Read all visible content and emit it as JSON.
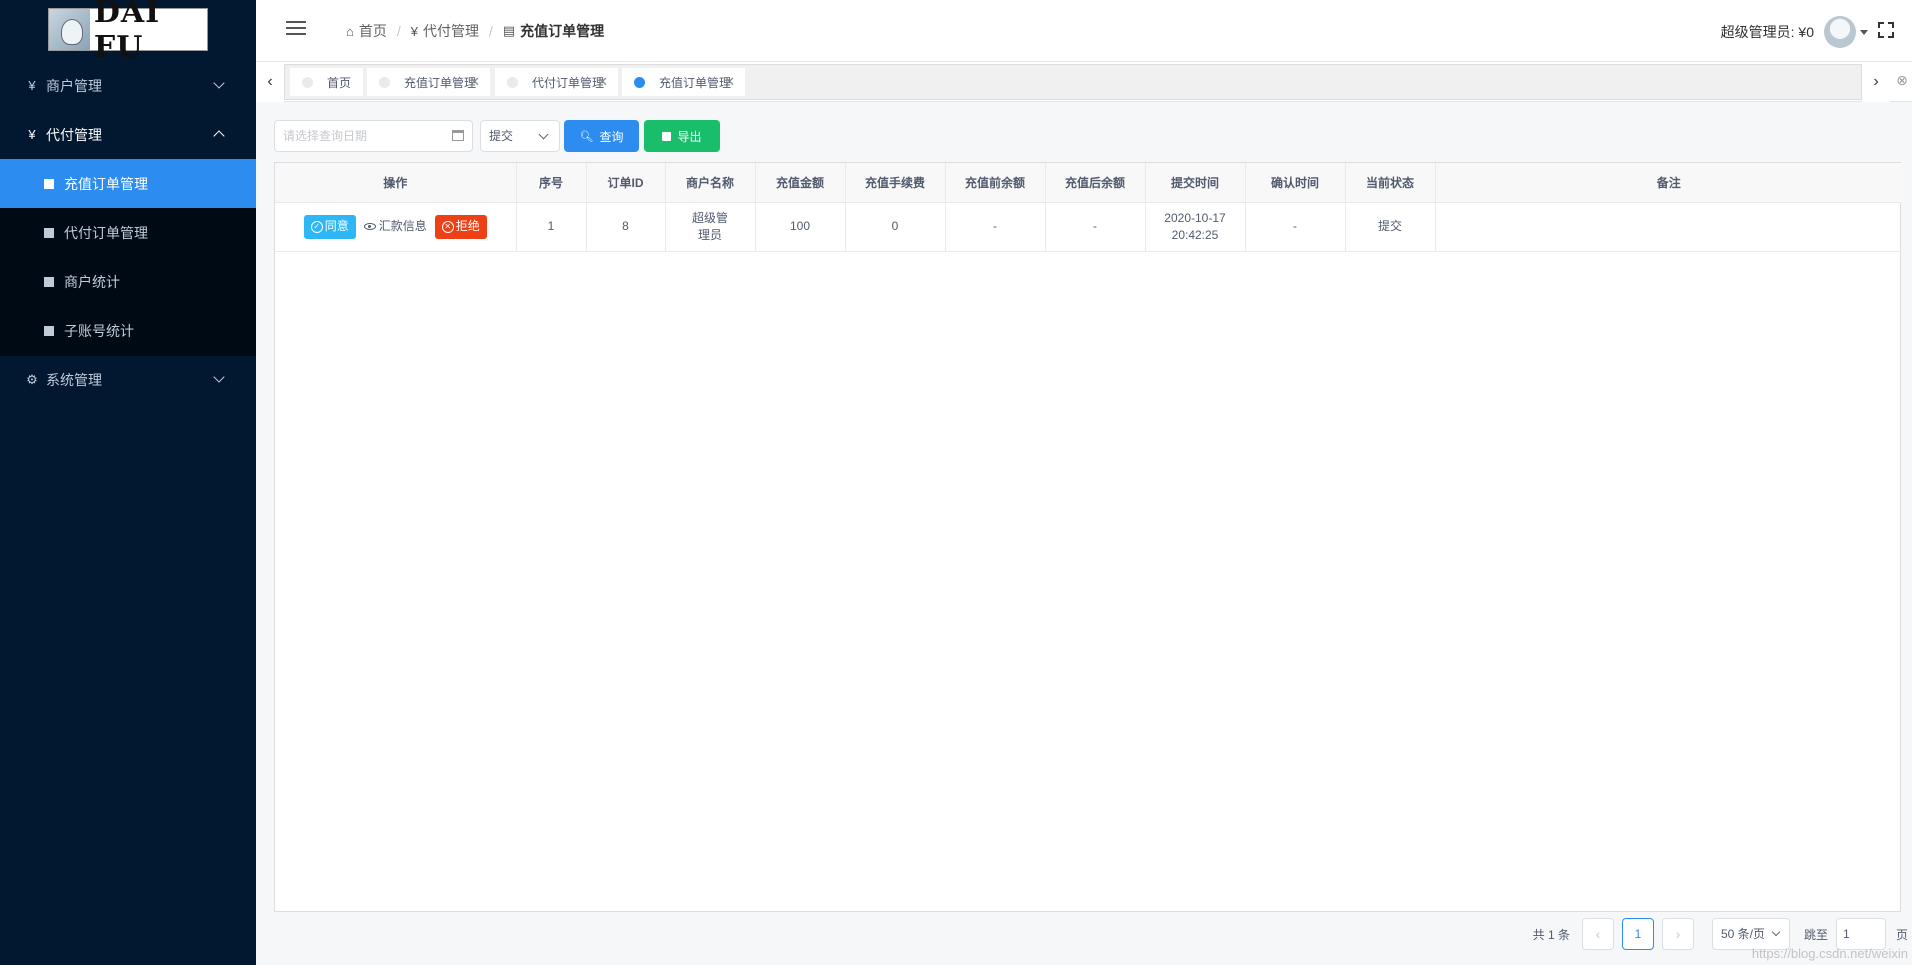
{
  "brand": {
    "logo_text": "DAI FU"
  },
  "sidebar": {
    "menus": [
      {
        "icon": "yen-icon",
        "glyph": "¥",
        "label": "商户管理",
        "expanded": false
      },
      {
        "icon": "yen-icon",
        "glyph": "¥",
        "label": "代付管理",
        "expanded": true
      },
      {
        "icon": "gear-icon",
        "glyph": "⚙",
        "label": "系统管理",
        "expanded": false
      }
    ],
    "submenu": [
      {
        "label": "充值订单管理",
        "active": true
      },
      {
        "label": "代付订单管理",
        "active": false
      },
      {
        "label": "商户统计",
        "active": false
      },
      {
        "label": "子账号统计",
        "active": false
      }
    ]
  },
  "header": {
    "breadcrumb": [
      {
        "icon": "home-icon",
        "glyph": "⌂",
        "label": "首页"
      },
      {
        "icon": "yen-icon",
        "glyph": "¥",
        "label": "代付管理"
      },
      {
        "icon": "doc-icon",
        "glyph": "▤",
        "label": "充值订单管理"
      }
    ],
    "user_label": "超级管理员: ¥0"
  },
  "tabs": [
    {
      "label": "首页",
      "active": false,
      "closable": false
    },
    {
      "label": "充值订单管理",
      "active": false,
      "closable": true
    },
    {
      "label": "代付订单管理",
      "active": false,
      "closable": true
    },
    {
      "label": "充值订单管理",
      "active": true,
      "closable": true
    }
  ],
  "filters": {
    "date_placeholder": "请选择查询日期",
    "status_value": "提交",
    "query_label": "查询",
    "export_label": "导出"
  },
  "table": {
    "columns": [
      "操作",
      "序号",
      "订单ID",
      "商户名称",
      "充值金额",
      "充值手续费",
      "充值前余额",
      "充值后余额",
      "提交时间",
      "确认时间",
      "当前状态",
      "备注"
    ],
    "actions": {
      "approve": "同意",
      "info": "汇款信息",
      "reject": "拒绝"
    },
    "rows": [
      {
        "index": "1",
        "order_id": "8",
        "merchant": "超级管理员",
        "amount": "100",
        "fee": "0",
        "before": "-",
        "after": "-",
        "submit_time": "2020-10-17 20:42:25",
        "confirm_time": "-",
        "status": "提交",
        "remark": ""
      }
    ]
  },
  "pagination": {
    "total": "共 1 条",
    "current_page": "1",
    "page_size": "50 条/页",
    "jump_label": "跳至",
    "jump_value": "1",
    "page_unit": "页"
  },
  "watermark": "https://blog.csdn.net/weixin"
}
